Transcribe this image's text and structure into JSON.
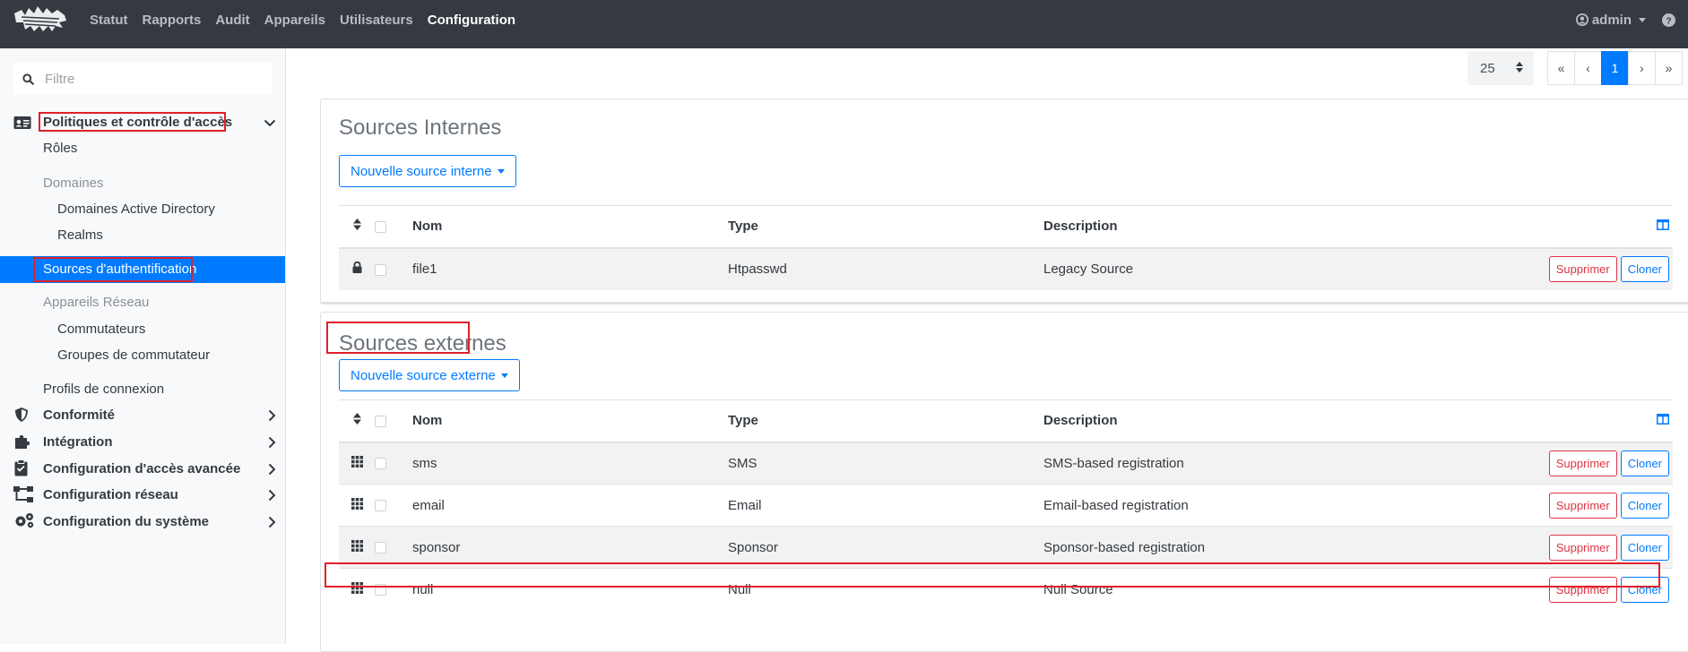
{
  "navbar": {
    "links": [
      "Statut",
      "Rapports",
      "Audit",
      "Appareils",
      "Utilisateurs",
      "Configuration"
    ],
    "active": "Configuration",
    "user": "admin"
  },
  "sidebar": {
    "filter_placeholder": "Filtre",
    "section_title": "Politiques et contrôle d'accès",
    "items": {
      "roles": "Rôles",
      "domaines": "Domaines",
      "ad_domains": "Domaines Active Directory",
      "realms": "Realms",
      "auth_sources": "Sources d'authentification",
      "network_devices": "Appareils Réseau",
      "switches": "Commutateurs",
      "switch_groups": "Groupes de commutateur",
      "connection_profiles": "Profils de connexion"
    },
    "sections": [
      "Conformité",
      "Intégration",
      "Configuration d'accès avancée",
      "Configuration réseau",
      "Configuration du système"
    ]
  },
  "pagination": {
    "per_page": "25",
    "first": "«",
    "prev": "‹",
    "current": "1",
    "next": "›",
    "last": "»"
  },
  "internal": {
    "title": "Sources Internes",
    "new_button": "Nouvelle source interne",
    "headers": [
      "Nom",
      "Type",
      "Description"
    ],
    "rows": [
      {
        "nom": "file1",
        "type": "Htpasswd",
        "description": "Legacy Source"
      }
    ]
  },
  "external": {
    "title": "Sources externes",
    "new_button": "Nouvelle source externe",
    "headers": [
      "Nom",
      "Type",
      "Description"
    ],
    "rows": [
      {
        "nom": "sms",
        "type": "SMS",
        "description": "SMS-based registration"
      },
      {
        "nom": "email",
        "type": "Email",
        "description": "Email-based registration"
      },
      {
        "nom": "sponsor",
        "type": "Sponsor",
        "description": "Sponsor-based registration"
      },
      {
        "nom": "null",
        "type": "Null",
        "description": "Null Source"
      }
    ]
  },
  "actions": {
    "delete": "Supprimer",
    "clone": "Cloner"
  },
  "colors": {
    "navbar": "#343a40",
    "primary": "#007bff",
    "danger": "#dc3545",
    "highlight": "#e0202a"
  }
}
